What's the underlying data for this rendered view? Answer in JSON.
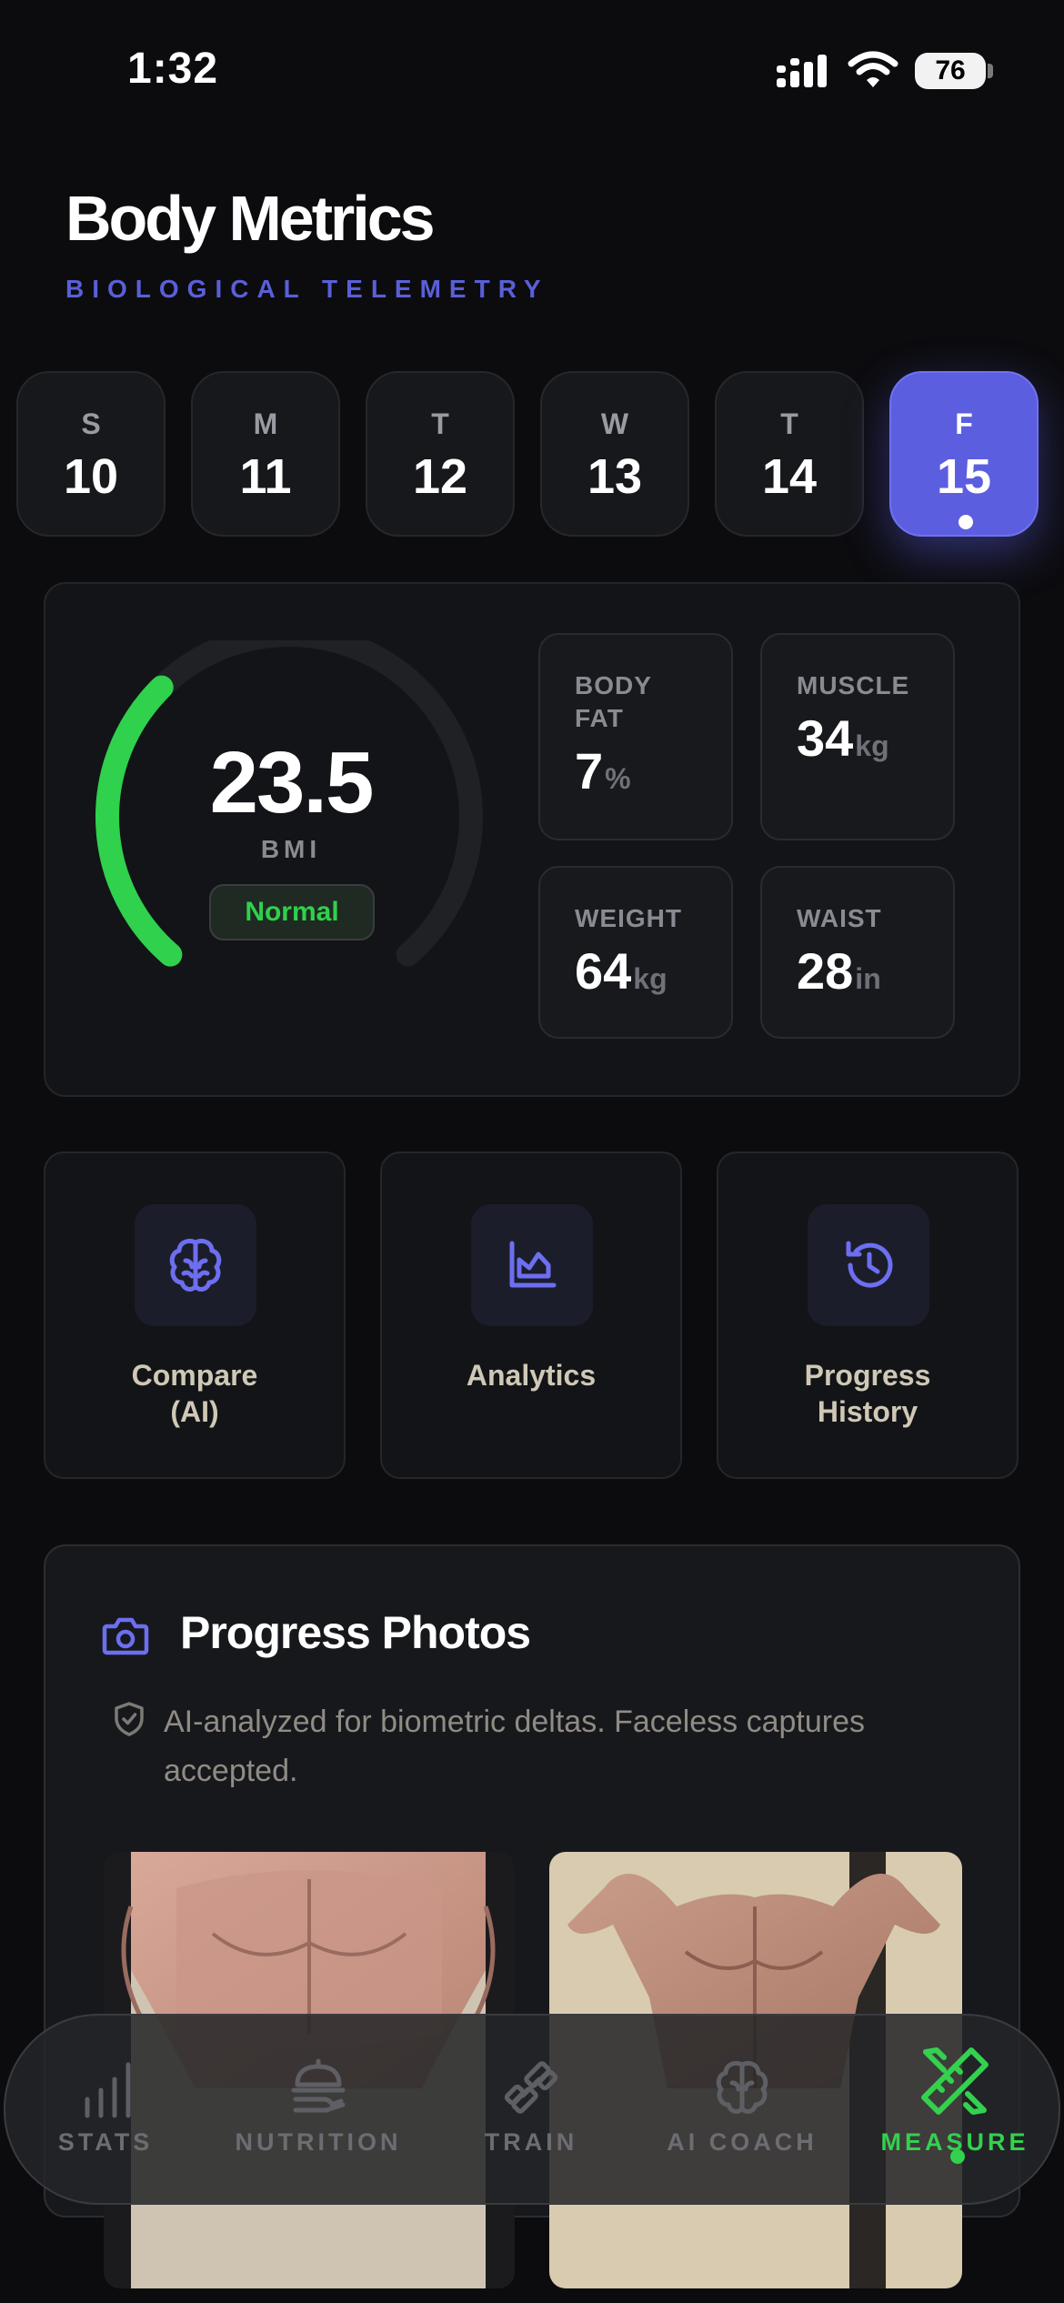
{
  "status_bar": {
    "time": "1:32",
    "battery": "76"
  },
  "header": {
    "title": "Body Metrics",
    "subtitle": "BIOLOGICAL TELEMETRY"
  },
  "days": [
    {
      "dow": "S",
      "num": "10"
    },
    {
      "dow": "M",
      "num": "11"
    },
    {
      "dow": "T",
      "num": "12"
    },
    {
      "dow": "W",
      "num": "13"
    },
    {
      "dow": "T",
      "num": "14"
    },
    {
      "dow": "F",
      "num": "15",
      "selected": true
    }
  ],
  "bmi": {
    "value": "23.5",
    "label": "BMI",
    "status": "Normal",
    "gauge_fill_fraction": 0.34
  },
  "metrics": [
    {
      "label": "BODY FAT",
      "value": "7",
      "unit": "%"
    },
    {
      "label": "MUSCLE",
      "value": "34",
      "unit": "kg"
    },
    {
      "label": "WEIGHT",
      "value": "64",
      "unit": "kg"
    },
    {
      "label": "WAIST",
      "value": "28",
      "unit": "in"
    }
  ],
  "actions": [
    {
      "label": "Compare\n(AI)",
      "icon": "brain-icon"
    },
    {
      "label": "Analytics",
      "icon": "chart-icon"
    },
    {
      "label": "Progress\nHistory",
      "icon": "history-icon"
    }
  ],
  "photos": {
    "title": "Progress Photos",
    "description": "AI-analyzed for biometric deltas. Faceless captures accepted."
  },
  "tabs": [
    {
      "label": "STATS",
      "icon": "stats-icon"
    },
    {
      "label": "NUTRITION",
      "icon": "nutrition-icon"
    },
    {
      "label": "TRAIN",
      "icon": "dumbbell-icon"
    },
    {
      "label": "AI COACH",
      "icon": "brain-icon"
    },
    {
      "label": "MEASURE",
      "icon": "ruler-pencil-icon",
      "active": true
    }
  ],
  "colors": {
    "accent": "#5c5ee0",
    "green": "#2fd14d",
    "background": "#0c0c0f"
  }
}
